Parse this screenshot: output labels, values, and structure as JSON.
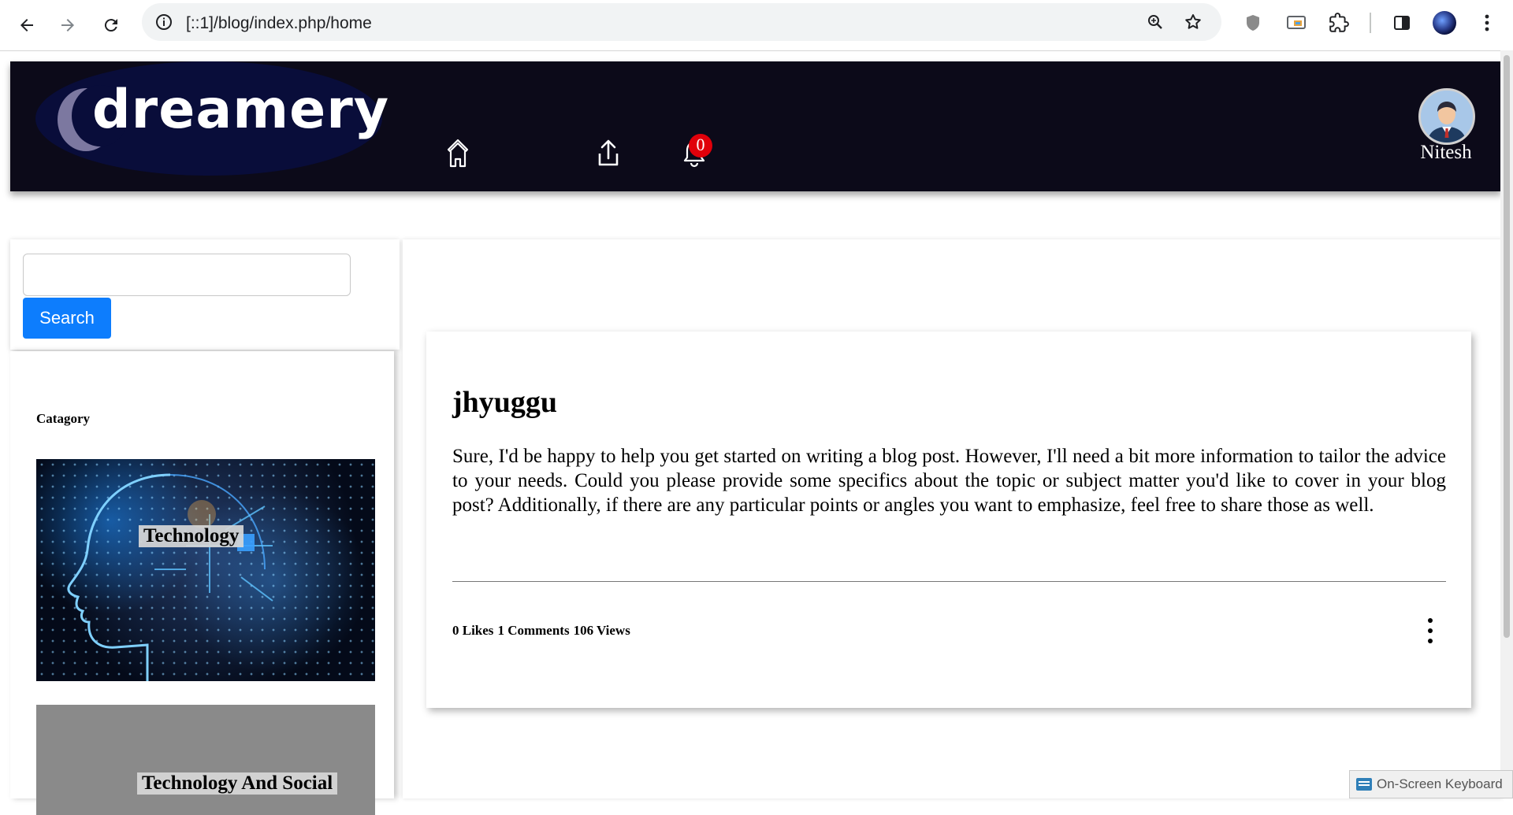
{
  "browser": {
    "url": "[::1]/blog/index.php/home",
    "icons": [
      "back-icon",
      "forward-icon",
      "reload-icon",
      "site-info-icon",
      "zoom-icon",
      "bookmark-star-icon",
      "shield-extension-icon",
      "cast-icon",
      "extensions-puzzle-icon",
      "side-panel-icon",
      "profile-avatar",
      "menu-dots-icon"
    ]
  },
  "header": {
    "logo_text": "dreamery",
    "user_name": "Nitesh",
    "notification_count": "0",
    "icons": [
      "home-icon",
      "upload-icon",
      "bell-icon"
    ],
    "colors": {
      "background": "#0c0a19",
      "badge": "#e0000a"
    }
  },
  "sidebar": {
    "search_placeholder": "",
    "search_button": "Search",
    "category_heading": "Catagory",
    "categories": [
      {
        "label": "Technology"
      },
      {
        "label": "Technology And Social"
      }
    ]
  },
  "post": {
    "title": "jhyuggu",
    "body": "Sure, I'd be happy to help you get started on writing a blog post. However, I'll need a bit more information to tailor the advice to your needs. Could you please provide some specifics about the topic or subject matter you'd like to cover in your blog post? Additionally, if there are any particular points or angles you want to emphasize, feel free to share those as well.",
    "likes": "0 Likes",
    "comments": "1 Comments",
    "views": "106 Views"
  },
  "taskbar": {
    "osk_label": "On-Screen Keyboard"
  },
  "colors": {
    "accent": "#0d7dfd"
  }
}
